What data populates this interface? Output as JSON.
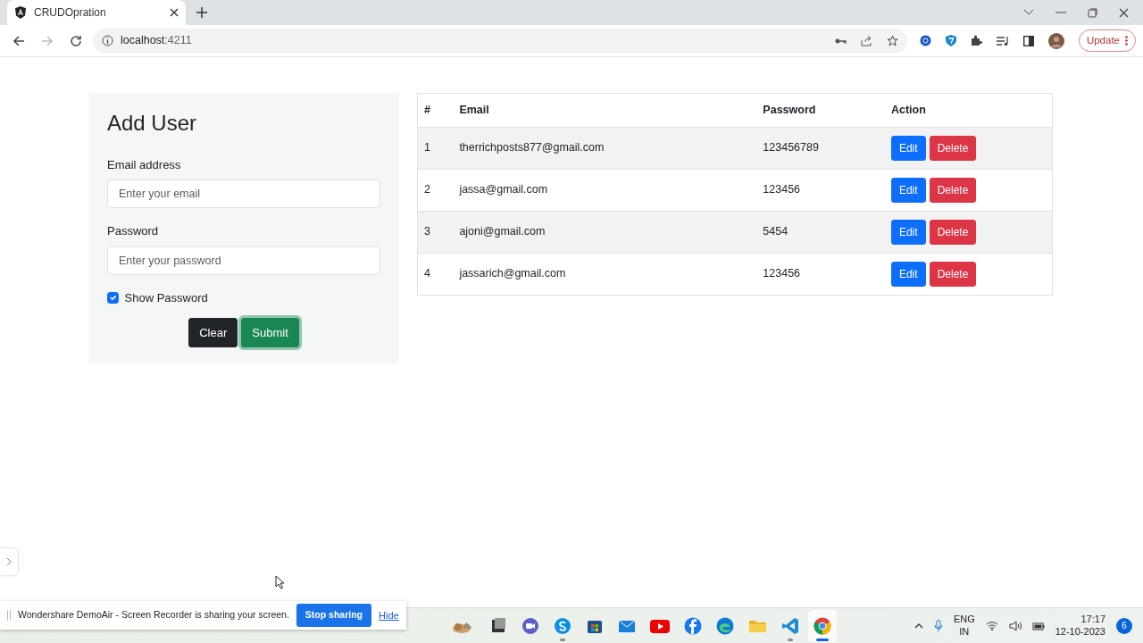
{
  "browser": {
    "tab_title": "CRUDOpration",
    "url_host": "localhost",
    "url_port": ":4211",
    "update_label": "Update"
  },
  "form": {
    "title": "Add User",
    "fields": [
      {
        "label": "Email address",
        "placeholder": "Enter your email"
      },
      {
        "label": "Password",
        "placeholder": "Enter your password"
      }
    ],
    "checkbox": {
      "label": "Show Password",
      "checked": true
    },
    "buttons": [
      {
        "label": "Clear",
        "kind": "dark",
        "focused": false
      },
      {
        "label": "Submit",
        "kind": "success",
        "focused": true
      }
    ]
  },
  "table": {
    "columns": [
      "#",
      "Email",
      "Password",
      "Action"
    ],
    "rows": [
      {
        "cells": [
          "1",
          "therrichposts877@gmail.com",
          "123456789"
        ],
        "actions": [
          "Edit",
          "Delete"
        ]
      },
      {
        "cells": [
          "2",
          "jassa@gmail.com",
          "123456"
        ],
        "actions": [
          "Edit",
          "Delete"
        ]
      },
      {
        "cells": [
          "3",
          "ajoni@gmail.com",
          "5454"
        ],
        "actions": [
          "Edit",
          "Delete"
        ]
      },
      {
        "cells": [
          "4",
          "jassarich@gmail.com",
          "123456"
        ],
        "actions": [
          "Edit",
          "Delete"
        ]
      }
    ]
  },
  "share_bar": {
    "message": "Wondershare DemoAir - Screen Recorder is sharing your screen.",
    "stop_label": "Stop sharing",
    "hide_label": "Hide"
  },
  "taskbar": {
    "apps": [
      {
        "kind": "photo",
        "running": false,
        "selected": false
      },
      {
        "kind": "window",
        "running": false,
        "selected": false
      },
      {
        "kind": "chat",
        "running": false,
        "selected": false
      },
      {
        "kind": "skype",
        "running": true,
        "selected": false
      },
      {
        "kind": "store",
        "running": false,
        "selected": false
      },
      {
        "kind": "mail",
        "running": false,
        "selected": false
      },
      {
        "kind": "youtube",
        "running": false,
        "selected": false
      },
      {
        "kind": "facebook",
        "running": false,
        "selected": false
      },
      {
        "kind": "edge",
        "running": false,
        "selected": false
      },
      {
        "kind": "folder",
        "running": false,
        "selected": false
      },
      {
        "kind": "vscode",
        "running": true,
        "selected": false
      },
      {
        "kind": "chrome",
        "running": true,
        "selected": true
      }
    ],
    "lang": "ENG",
    "region": "IN",
    "time": "17:17",
    "date": "12-10-2023",
    "notifications": "6"
  }
}
